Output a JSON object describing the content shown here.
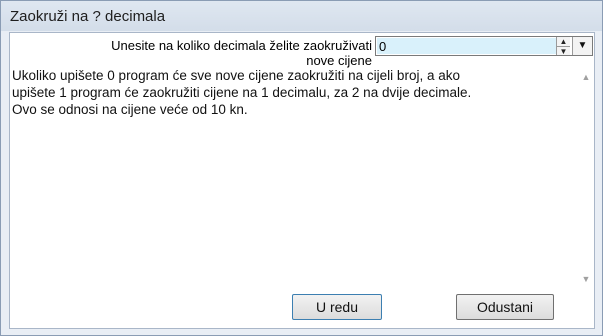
{
  "window": {
    "title": "Zaokruži na ? decimala"
  },
  "prompt": {
    "label_line1": "Unesite na koliko decimala želite zaokruživati",
    "label_line2": "nove cijene"
  },
  "decimals_input": {
    "value": "0"
  },
  "icons": {
    "spin_up": "spin-up-icon",
    "spin_down": "spin-down-icon",
    "dropdown": "chevron-down-icon",
    "scroll_up": "scroll-up-icon",
    "scroll_down": "scroll-down-icon"
  },
  "info": {
    "line1": "Ukoliko upišete 0 program će sve nove cijene zaokružiti na cijeli broj, a ako",
    "line2": "upišete 1 program će zaokružiti cijene na 1 decimalu, za 2 na dvije decimale.",
    "line3": "Ovo se odnosi na cijene veće od 10 kn."
  },
  "buttons": {
    "ok_label": "U redu",
    "cancel_label": "Odustani"
  },
  "colors": {
    "input_highlight": "#d9f1fb",
    "window_frame": "#e9eef5"
  }
}
